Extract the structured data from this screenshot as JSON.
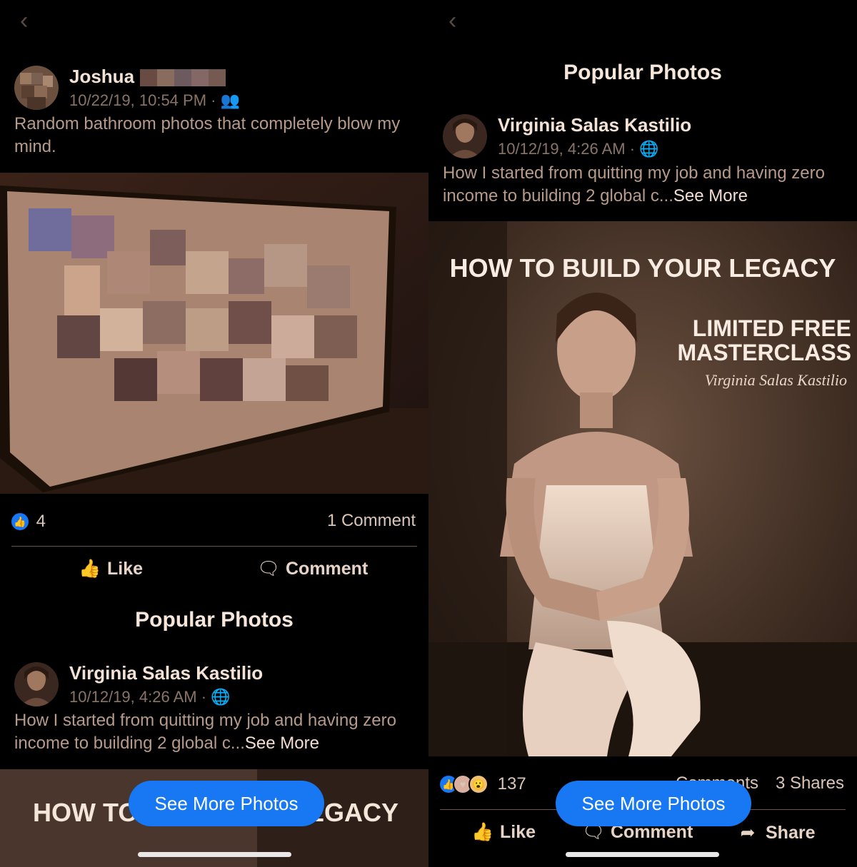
{
  "left": {
    "post": {
      "author": "Joshua",
      "timestamp": "10/22/19, 10:54 PM",
      "audience_icon": "friends-icon",
      "text": "Random bathroom photos that completely blow my mind.",
      "reaction_count": "4",
      "comments_label": "1 Comment"
    },
    "actions": {
      "like": "Like",
      "comment": "Comment"
    },
    "popular_title": "Popular Photos",
    "popular_post": {
      "author": "Virginia Salas Kastilio",
      "timestamp": "10/12/19, 4:26 AM",
      "audience_icon": "globe-icon",
      "text": "How I started from quitting my job and having zero income to building 2 global c...",
      "see_more": "See More",
      "image_heading_left": "HOW TO",
      "image_heading_right": "EGACY"
    },
    "see_more_photos": "See More Photos"
  },
  "right": {
    "popular_title": "Popular Photos",
    "post": {
      "author": "Virginia Salas Kastilio",
      "timestamp": "10/12/19, 4:26 AM",
      "audience_icon": "globe-icon",
      "text": "How I started from quitting my job and having zero income to building 2 global c...",
      "see_more": "See More",
      "image_heading": "HOW TO BUILD YOUR LEGACY",
      "image_promo_line1": "LIMITED FREE",
      "image_promo_line2": "MASTERCLASS",
      "image_signature": "Virginia Salas Kastilio",
      "reaction_count": "137",
      "comments_label": "Comments",
      "shares_label": "3 Shares"
    },
    "actions": {
      "like": "Like",
      "comment": "Comment",
      "share": "Share"
    },
    "see_more_photos": "See More Photos"
  },
  "colors": {
    "accent": "#1877f2",
    "background": "#000000",
    "text_tint": "#f2ddd0"
  }
}
